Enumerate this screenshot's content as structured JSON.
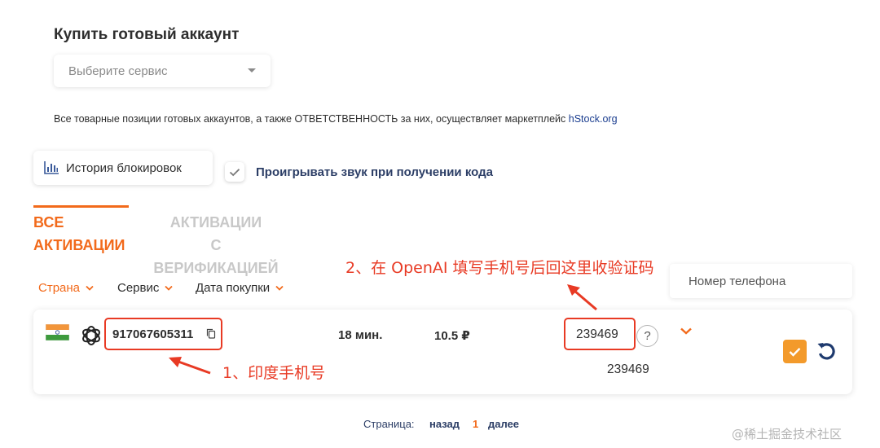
{
  "header": {
    "title": "Купить готовый аккаунт"
  },
  "service_select": {
    "placeholder": "Выберите сервис"
  },
  "disclaimer": {
    "text": "Все товарные позиции готовых аккаунтов, а также ОТВЕТСТВЕННОСТЬ за них, осуществляет маркетплейс ",
    "link": "hStock.org"
  },
  "toolbar": {
    "history_label": "История блокировок",
    "sound_label": "Проигрывать звук при получении кода",
    "sound_checked": true
  },
  "tabs": [
    {
      "line1": "ВСЕ",
      "line2": "АКТИВАЦИИ",
      "active": true
    },
    {
      "line1": "АКТИВАЦИИ",
      "line2": "С ВЕРИФИКАЦИЕЙ",
      "active": false
    }
  ],
  "filters": {
    "country": "Страна",
    "service": "Сервис",
    "date": "Дата покупки"
  },
  "search": {
    "placeholder": "Номер телефона"
  },
  "activation": {
    "country_icon": "flag-india-icon",
    "service_icon": "openai-icon",
    "phone": "917067605311",
    "time": "18 мин.",
    "price": "10.5 ₽",
    "code": "239469",
    "help": "?",
    "code_history": "239469"
  },
  "annotations": {
    "step1": "1、印度手机号",
    "step2": "2、在 OpenAI 填写手机号后回这里收验证码"
  },
  "pagination": {
    "label": "Страница:",
    "back": "назад",
    "current": "1",
    "next": "далее"
  },
  "watermark": "@稀土掘金技术社区",
  "colors": {
    "accent": "#f26a1b",
    "annotation": "#e83a24",
    "link": "#1a3d8f",
    "confirm": "#f39a2b"
  }
}
